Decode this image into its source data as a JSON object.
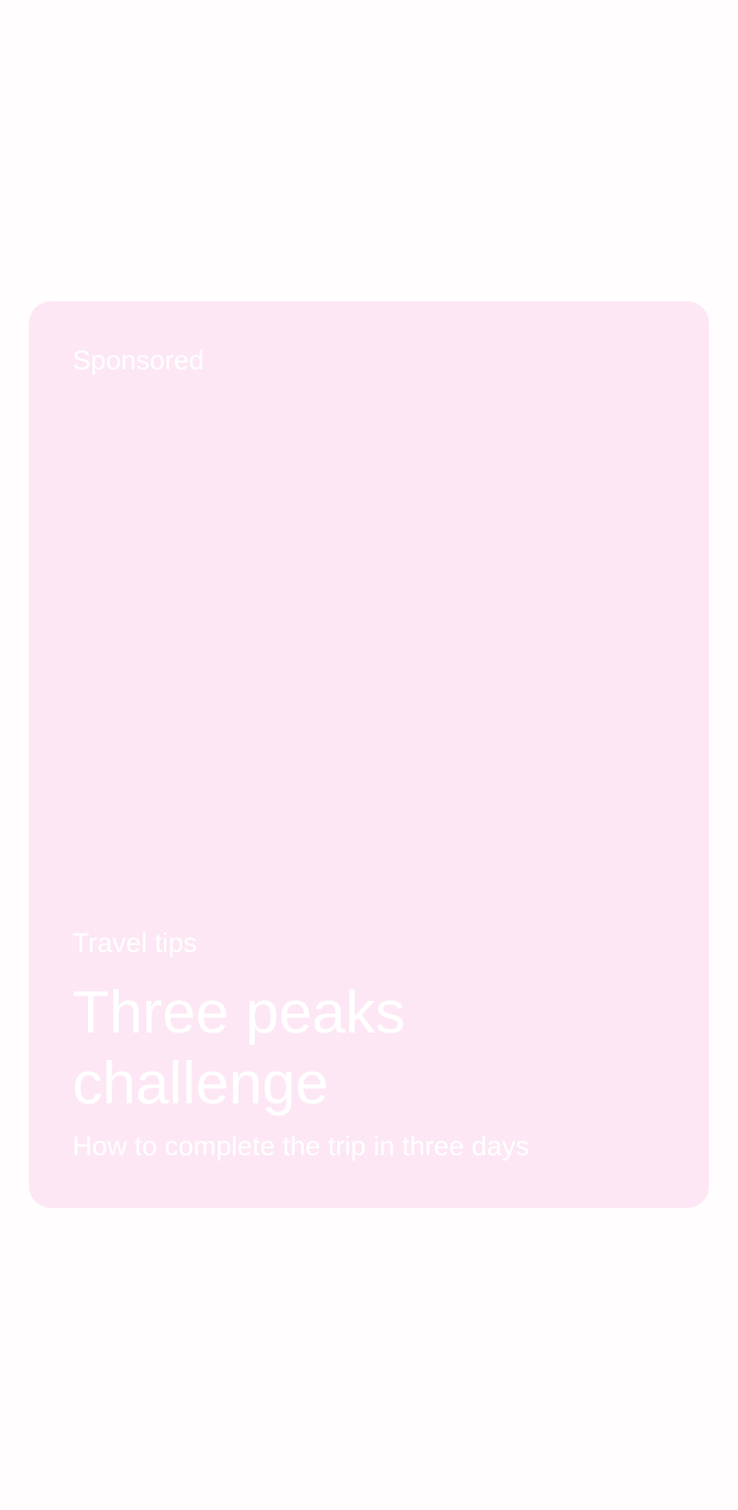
{
  "card": {
    "sponsored_label": "Sponsored",
    "category": "Travel tips",
    "title": "Three peaks challenge",
    "subtitle": "How to complete the trip in three days"
  },
  "colors": {
    "page_background": "#fffdfd",
    "card_background": "#fde7f4",
    "text": "#ffffff"
  }
}
